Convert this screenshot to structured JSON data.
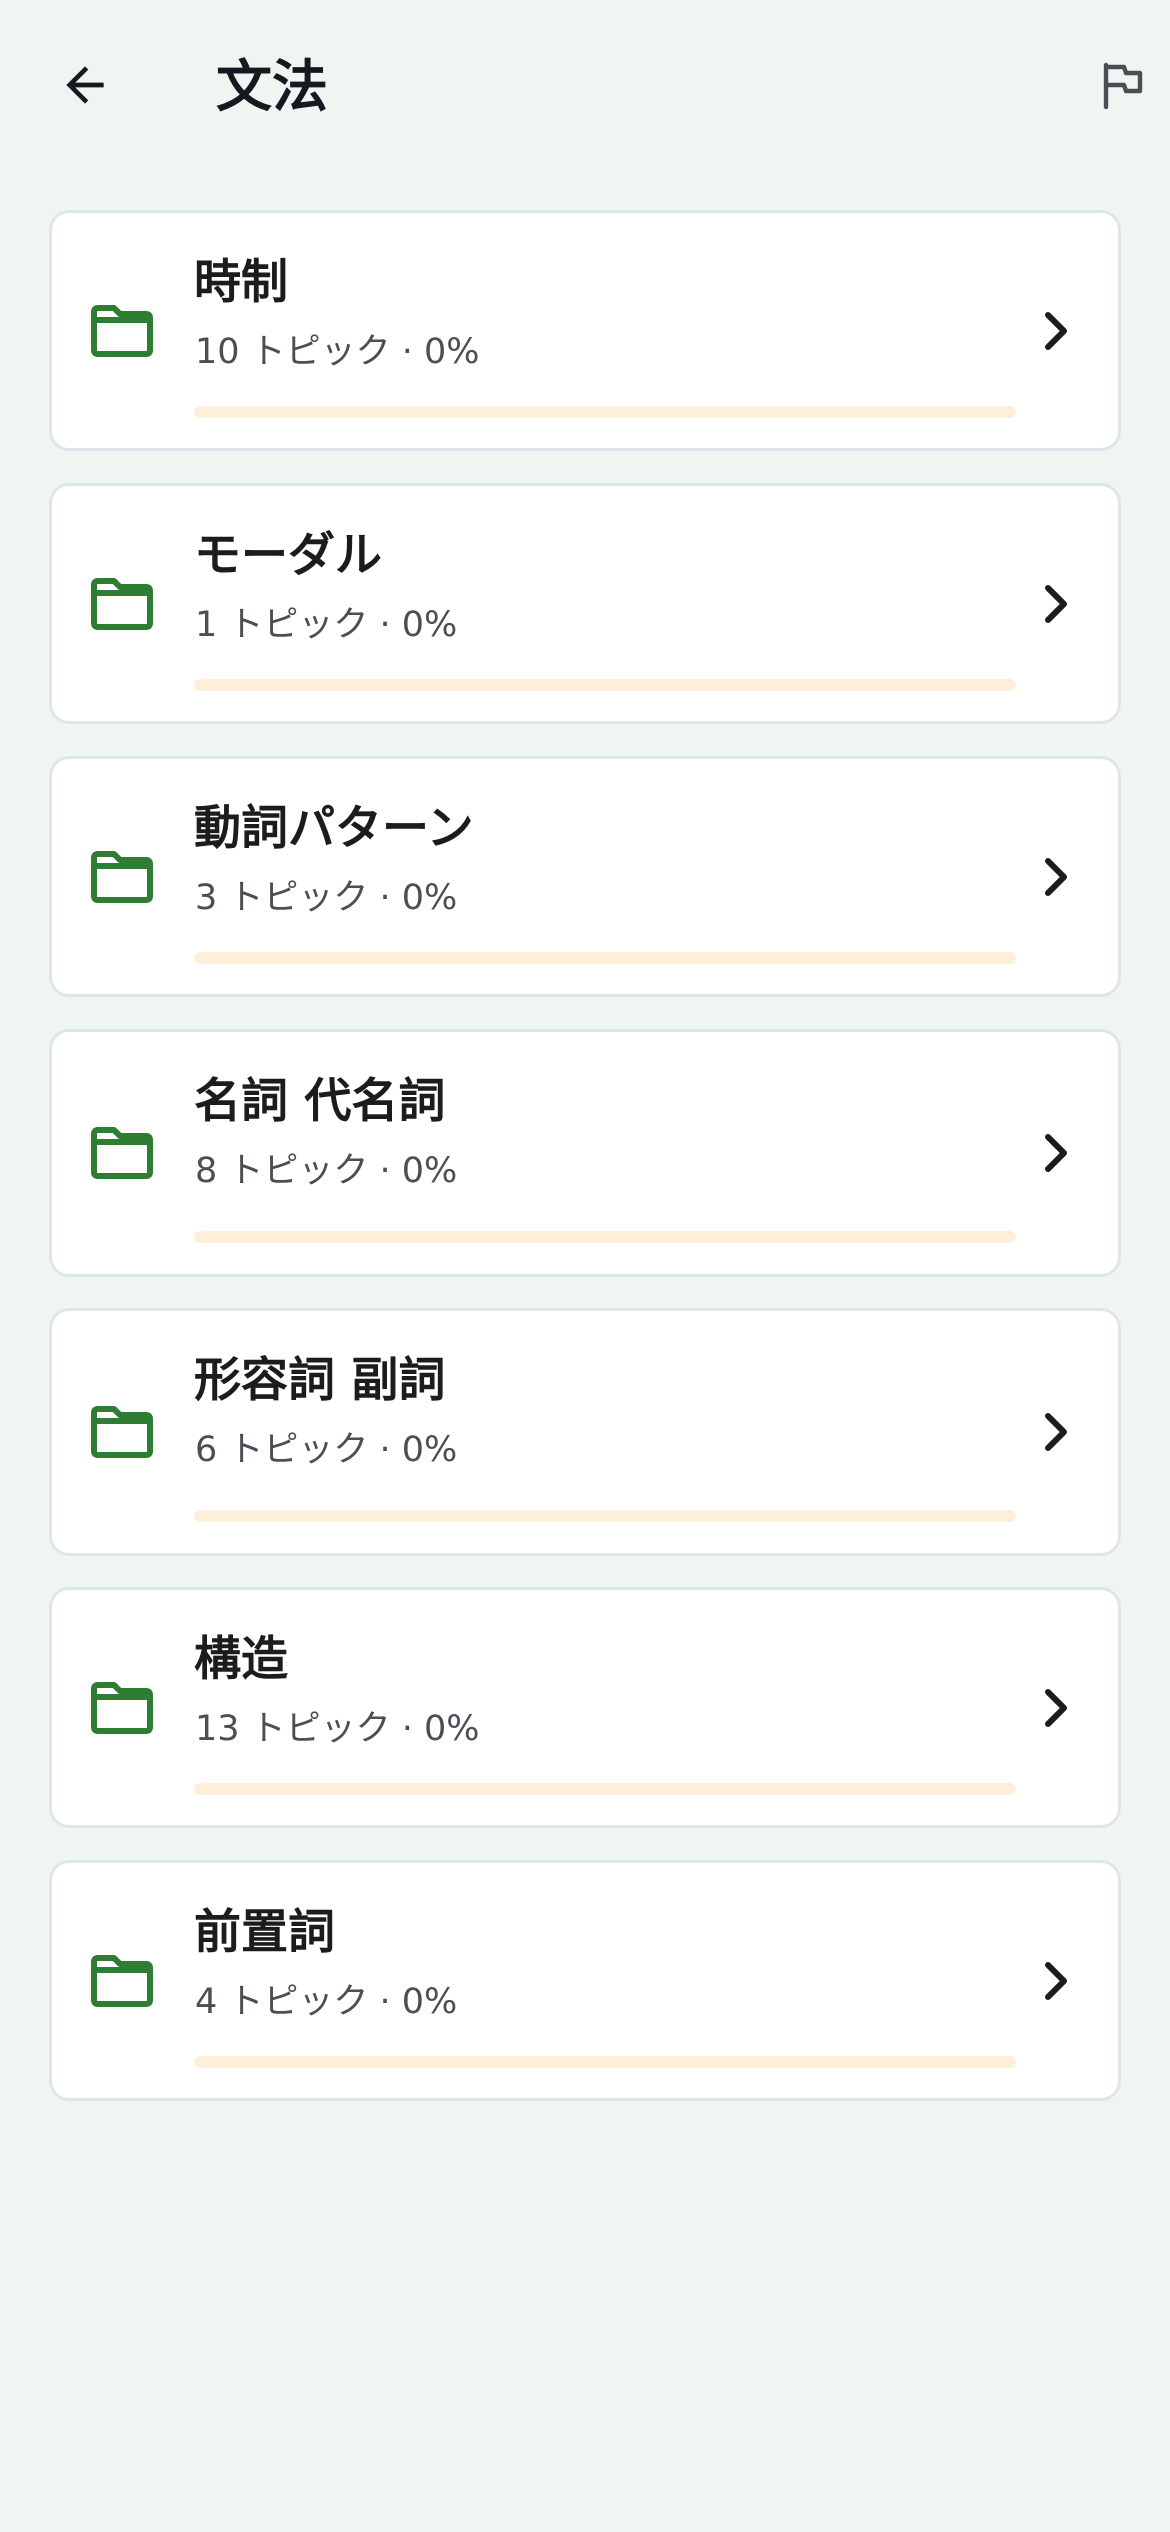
{
  "header": {
    "title": "文法",
    "back_icon": "arrow-left-icon",
    "flag_icon": "flag-icon"
  },
  "colors": {
    "background": "#eff5f1",
    "folder": "#2f7d32",
    "progress_track": "#fdefd9",
    "text_primary": "#1b1c1e",
    "text_secondary": "#4b4f55"
  },
  "categories": [
    {
      "title": "時制",
      "subtitle": "10 トピック · 0%",
      "progress": 0
    },
    {
      "title": "モーダル",
      "subtitle": "1 トピック · 0%",
      "progress": 0
    },
    {
      "title": "動詞パターン",
      "subtitle": "3 トピック · 0%",
      "progress": 0
    },
    {
      "title": "名詞 代名詞",
      "subtitle": "8 トピック · 0%",
      "progress": 0
    },
    {
      "title": "形容詞 副詞",
      "subtitle": "6 トピック · 0%",
      "progress": 0
    },
    {
      "title": "構造",
      "subtitle": "13 トピック · 0%",
      "progress": 0
    },
    {
      "title": "前置詞",
      "subtitle": "4 トピック · 0%",
      "progress": 0
    }
  ]
}
